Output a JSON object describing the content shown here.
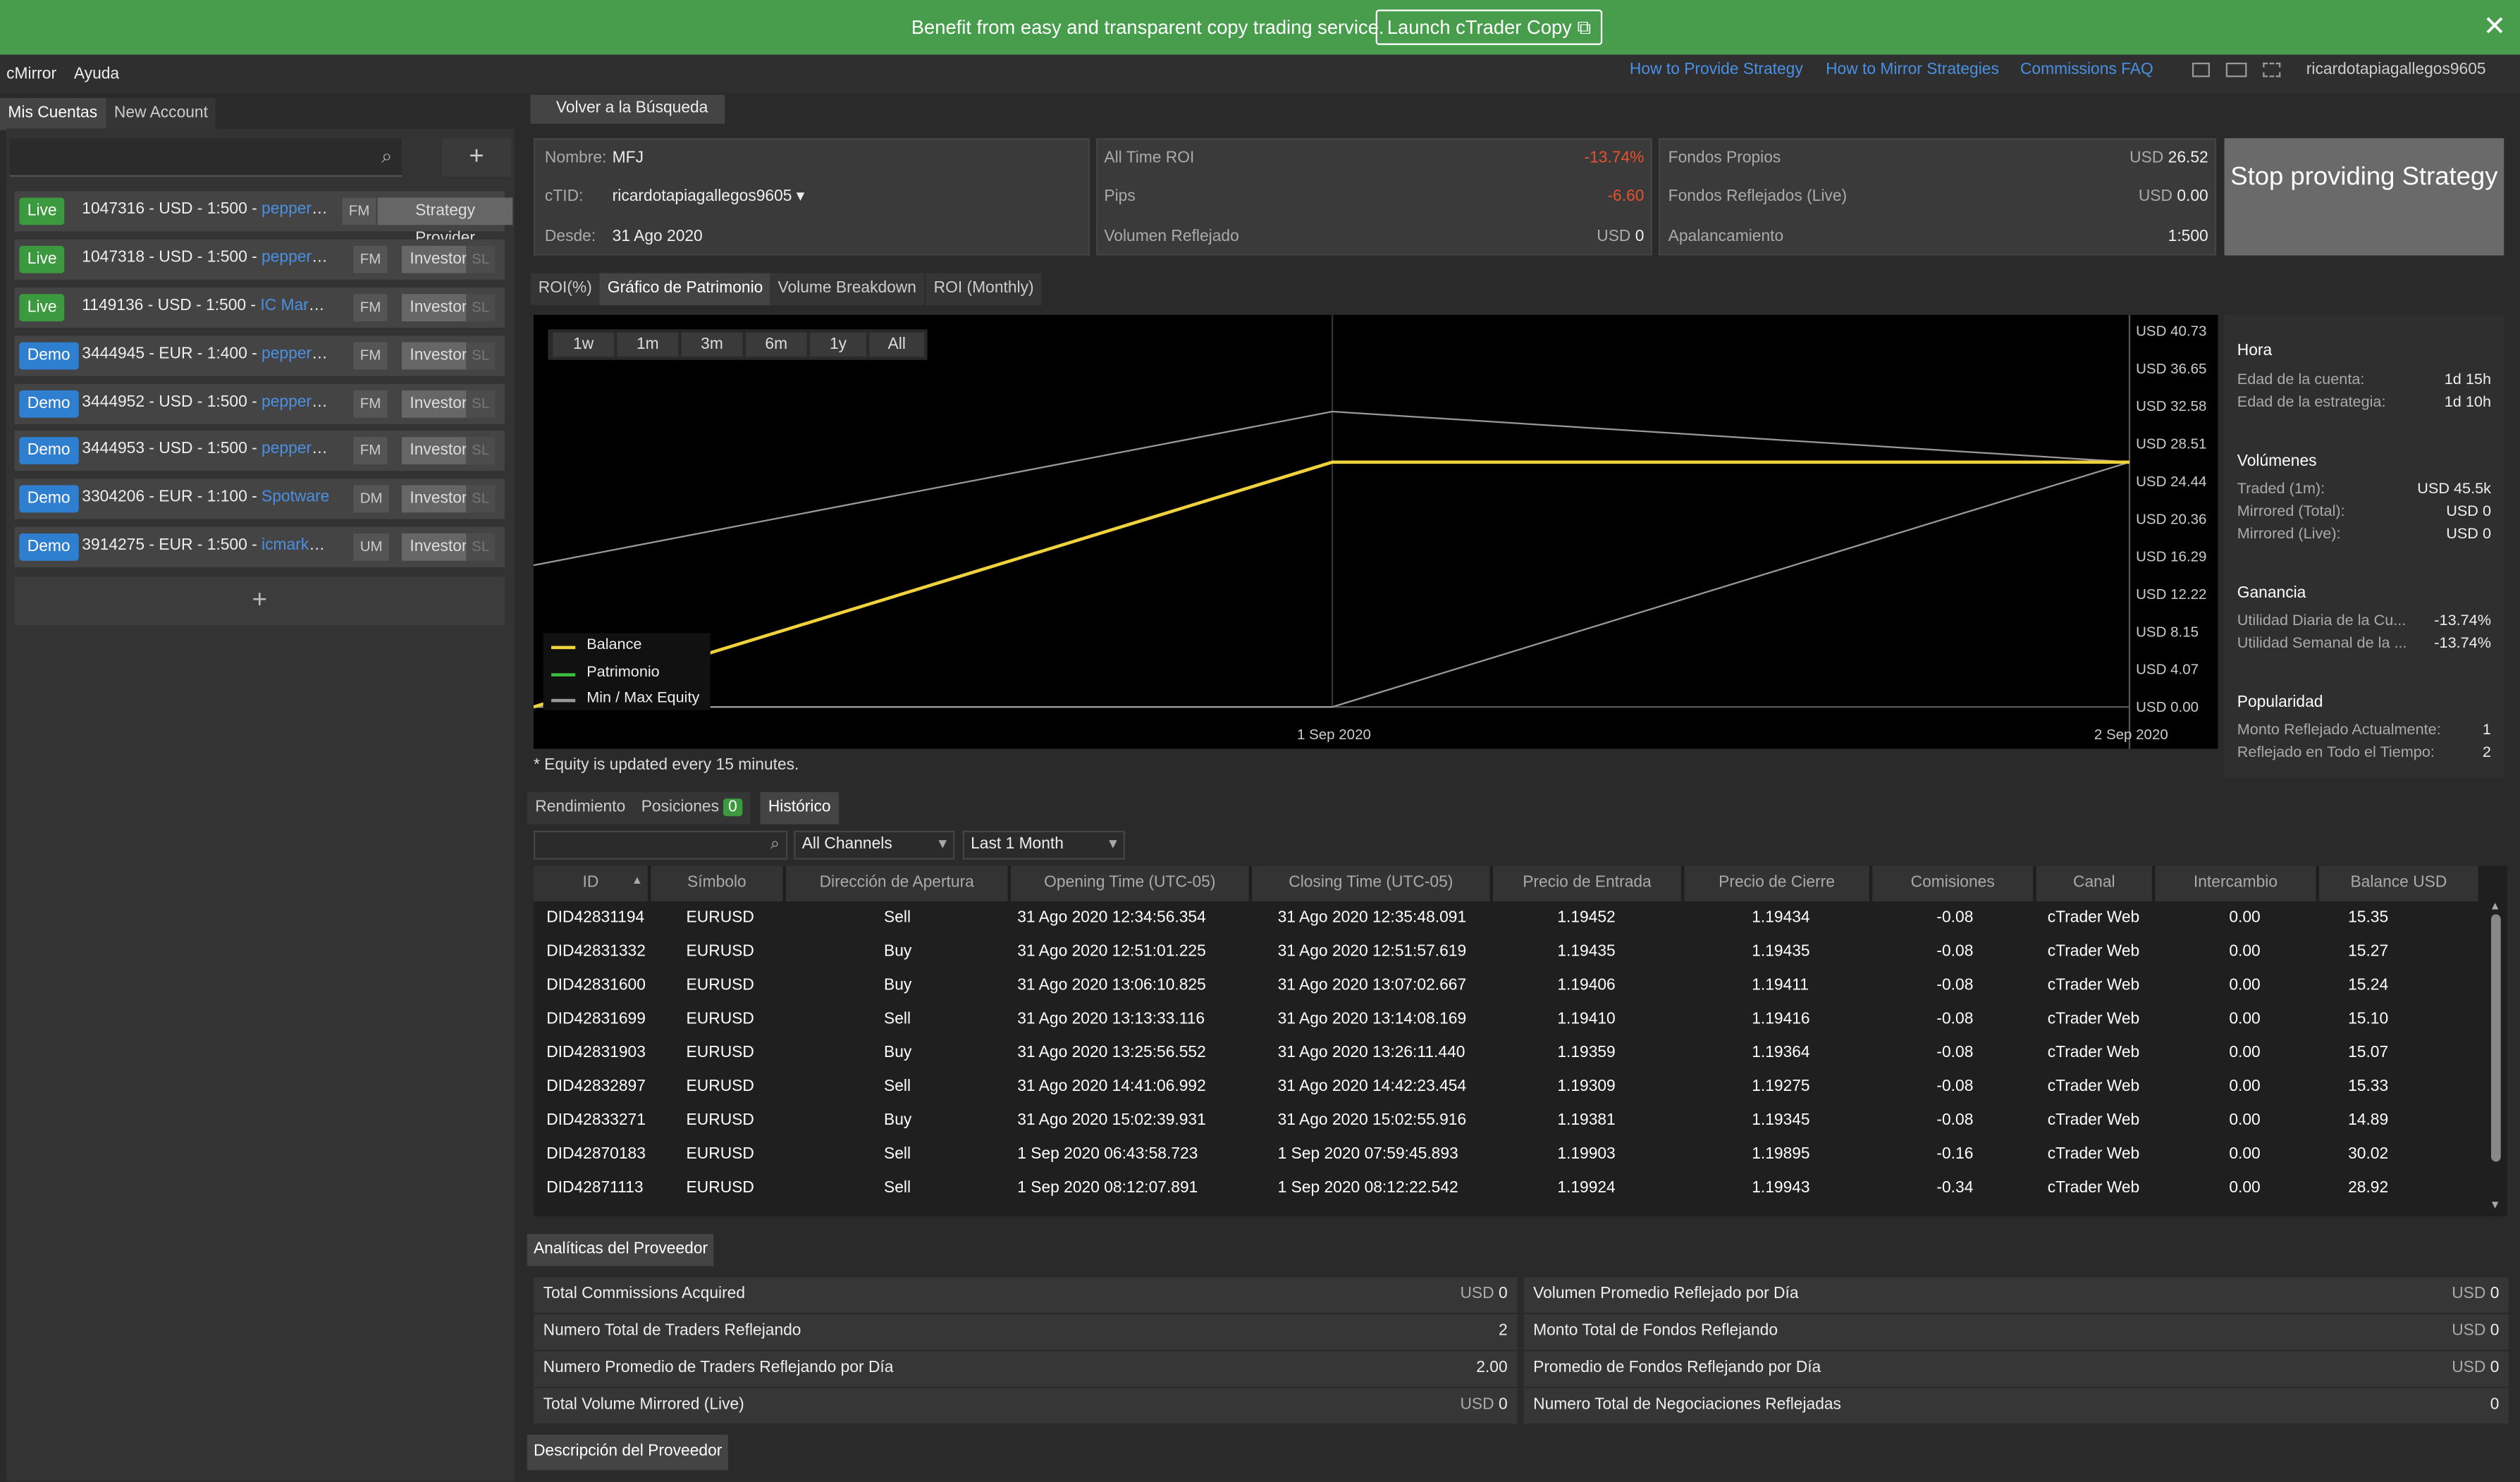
{
  "banner": {
    "text": "Benefit from easy and transparent copy trading service.",
    "button": "Launch cTrader Copy",
    "close": "close-icon"
  },
  "menu": {
    "app": "cMirror",
    "help": "Ayuda",
    "links": [
      "How to Provide Strategy",
      "How to Mirror Strategies",
      "Commissions FAQ"
    ],
    "user": "ricardotapiagallegos9605"
  },
  "left_tabs": [
    "Mis Cuentas",
    "New Account"
  ],
  "accounts": [
    {
      "type": "Live",
      "id": "1047316 - USD - 1:500 - ",
      "broker": "pepperstone",
      "tag": "FM",
      "role": "Strategy Provider",
      "sl": ""
    },
    {
      "type": "Live",
      "id": "1047318 - USD - 1:500 - ",
      "broker": "pepperstone",
      "tag": "FM",
      "role": "Investor",
      "sl": "SL"
    },
    {
      "type": "Live",
      "id": "1149136 - USD - 1:500 - ",
      "broker": "IC Markets",
      "tag": "FM",
      "role": "Investor",
      "sl": "SL"
    },
    {
      "type": "Demo",
      "id": "3444945 - EUR - 1:400 - ",
      "broker": "pepperstone",
      "tag": "FM",
      "role": "Investor",
      "sl": "SL"
    },
    {
      "type": "Demo",
      "id": "3444952 - USD - 1:500 - ",
      "broker": "pepperstone",
      "tag": "FM",
      "role": "Investor",
      "sl": "SL"
    },
    {
      "type": "Demo",
      "id": "3444953 - USD - 1:500 - ",
      "broker": "pepperstone",
      "tag": "FM",
      "role": "Investor",
      "sl": "SL"
    },
    {
      "type": "Demo",
      "id": "3304206 - EUR - 1:100 - ",
      "broker": "Spotware",
      "tag": "DM",
      "role": "Investor",
      "sl": "SL"
    },
    {
      "type": "Demo",
      "id": "3914275 - EUR - 1:500 - ",
      "broker": "icmarketssc",
      "tag": "UM",
      "role": "Investor",
      "sl": "SL"
    }
  ],
  "back": "Volver a la Búsqueda",
  "info": {
    "nombre_l": "Nombre:",
    "nombre": "MFJ",
    "ctid_l": "cTID:",
    "ctid": "ricardotapiagallegos9605",
    "desde_l": "Desde:",
    "desde": "31 Ago 2020",
    "roi_l": "All Time ROI",
    "roi": "-13.74%",
    "pips_l": "Pips",
    "pips": "-6.60",
    "vol_l": "Volumen Reflejado",
    "vol_u": "USD",
    "vol": "0",
    "fp_l": "Fondos Propios",
    "fp_u": "USD",
    "fp": "26.52",
    "fr_l": "Fondos Reflejados (Live)",
    "fr_u": "USD",
    "fr": "0.00",
    "ap_l": "Apalancamiento",
    "ap": "1:500"
  },
  "stop": "Stop providing Strategy",
  "chart_tabs": [
    "ROI(%)",
    "Gráfico de Patrimonio",
    "Volume Breakdown",
    "ROI (Monthly)"
  ],
  "ranges": [
    "1w",
    "1m",
    "3m",
    "6m",
    "1y",
    "All"
  ],
  "chart_data": {
    "type": "line",
    "x": [
      "31 Ago 2020",
      "1 Sep 2020",
      "2 Sep 2020"
    ],
    "x_ticks": [
      "1 Sep 2020",
      "2 Sep 2020"
    ],
    "y_ticks": [
      "USD 40.73",
      "USD 36.65",
      "USD 32.58",
      "USD 28.51",
      "USD 24.44",
      "USD 20.36",
      "USD 16.29",
      "USD 12.22",
      "USD 8.15",
      "USD 4.07",
      "USD 0.00"
    ],
    "ylim": [
      0,
      40.73
    ],
    "series": [
      {
        "name": "Balance",
        "color": "#f0d23c",
        "values": [
          0,
          26.52,
          26.52
        ]
      },
      {
        "name": "Patrimonio",
        "color": "#3cbf3c",
        "values": [
          0,
          26.52,
          26.52
        ]
      },
      {
        "name": "Min / Max Equity",
        "color": "#999999",
        "min": [
          0,
          0,
          26.52
        ],
        "max": [
          15.35,
          32.0,
          26.52
        ]
      }
    ],
    "note": "* Equity is updated every 15 minutes."
  },
  "side": {
    "hora": "Hora",
    "edad_c_l": "Edad de la cuenta:",
    "edad_c": "1d 15h",
    "edad_e_l": "Edad de la estrategia:",
    "edad_e": "1d 10h",
    "vol": "Volúmenes",
    "traded_l": "Traded (1m):",
    "traded": "USD  45.5k",
    "mt_l": "Mirrored (Total):",
    "mt": "USD  0",
    "ml_l": "Mirrored (Live):",
    "ml": "USD  0",
    "gan": "Ganancia",
    "ud_l": "Utilidad Diaria de la Cu...",
    "ud": "-13.74%",
    "us_l": "Utilidad Semanal de la ...",
    "us": "-13.74%",
    "pop": "Popularidad",
    "mr_l": "Monto Reflejado Actualmente:",
    "mr": "1",
    "rt_l": "Reflejado en Todo el Tiempo:",
    "rt": "2"
  },
  "hist_tabs": [
    "Rendimiento",
    "Posiciones",
    "Histórico"
  ],
  "pos_count": "0",
  "filters": {
    "channels": "All Channels",
    "period": "Last 1 Month"
  },
  "columns": [
    "ID",
    "Símbolo",
    "Dirección de Apertura",
    "Opening Time (UTC-05)",
    "Closing Time (UTC-05)",
    "Precio de Entrada",
    "Precio de Cierre",
    "Comisiones",
    "Canal",
    "Intercambio",
    "Balance USD"
  ],
  "rows": [
    [
      "DID42831194",
      "EURUSD",
      "Sell",
      "31 Ago 2020 12:34:56.354",
      "31 Ago 2020 12:35:48.091",
      "1.19452",
      "1.19434",
      "-0.08",
      "cTrader Web",
      "0.00",
      "15.35"
    ],
    [
      "DID42831332",
      "EURUSD",
      "Buy",
      "31 Ago 2020 12:51:01.225",
      "31 Ago 2020 12:51:57.619",
      "1.19435",
      "1.19435",
      "-0.08",
      "cTrader Web",
      "0.00",
      "15.27"
    ],
    [
      "DID42831600",
      "EURUSD",
      "Buy",
      "31 Ago 2020 13:06:10.825",
      "31 Ago 2020 13:07:02.667",
      "1.19406",
      "1.19411",
      "-0.08",
      "cTrader Web",
      "0.00",
      "15.24"
    ],
    [
      "DID42831699",
      "EURUSD",
      "Sell",
      "31 Ago 2020 13:13:33.116",
      "31 Ago 2020 13:14:08.169",
      "1.19410",
      "1.19416",
      "-0.08",
      "cTrader Web",
      "0.00",
      "15.10"
    ],
    [
      "DID42831903",
      "EURUSD",
      "Buy",
      "31 Ago 2020 13:25:56.552",
      "31 Ago 2020 13:26:11.440",
      "1.19359",
      "1.19364",
      "-0.08",
      "cTrader Web",
      "0.00",
      "15.07"
    ],
    [
      "DID42832897",
      "EURUSD",
      "Sell",
      "31 Ago 2020 14:41:06.992",
      "31 Ago 2020 14:42:23.454",
      "1.19309",
      "1.19275",
      "-0.08",
      "cTrader Web",
      "0.00",
      "15.33"
    ],
    [
      "DID42833271",
      "EURUSD",
      "Buy",
      "31 Ago 2020 15:02:39.931",
      "31 Ago 2020 15:02:55.916",
      "1.19381",
      "1.19345",
      "-0.08",
      "cTrader Web",
      "0.00",
      "14.89"
    ],
    [
      "DID42870183",
      "EURUSD",
      "Sell",
      "1 Sep 2020 06:43:58.723",
      "1 Sep 2020 07:59:45.893",
      "1.19903",
      "1.19895",
      "-0.16",
      "cTrader Web",
      "0.00",
      "30.02"
    ],
    [
      "DID42871113",
      "EURUSD",
      "Sell",
      "1 Sep 2020 08:12:07.891",
      "1 Sep 2020 08:12:22.542",
      "1.19924",
      "1.19943",
      "-0.34",
      "cTrader Web",
      "0.00",
      "28.92"
    ]
  ],
  "analytics_tab": "Analíticas del Proveedor",
  "analytics": [
    {
      "label": "Total Commissions Acquired",
      "unit": "USD",
      "value": "0"
    },
    {
      "label": "Volumen Promedio Reflejado por Día",
      "unit": "USD",
      "value": "0"
    },
    {
      "label": "Numero Total de Traders Reflejando",
      "unit": "",
      "value": "2"
    },
    {
      "label": "Monto Total de Fondos Reflejando",
      "unit": "USD",
      "value": "0"
    },
    {
      "label": "Numero Promedio de Traders Reflejando por Día",
      "unit": "",
      "value": "2.00"
    },
    {
      "label": "Promedio de Fondos Reflejando por Día",
      "unit": "USD",
      "value": "0"
    },
    {
      "label": "Total Volume Mirrored (Live)",
      "unit": "USD",
      "value": "0"
    },
    {
      "label": "Numero Total de Negociaciones Reflejadas",
      "unit": "",
      "value": "0"
    }
  ],
  "desc_tab": "Descripción del Proveedor"
}
